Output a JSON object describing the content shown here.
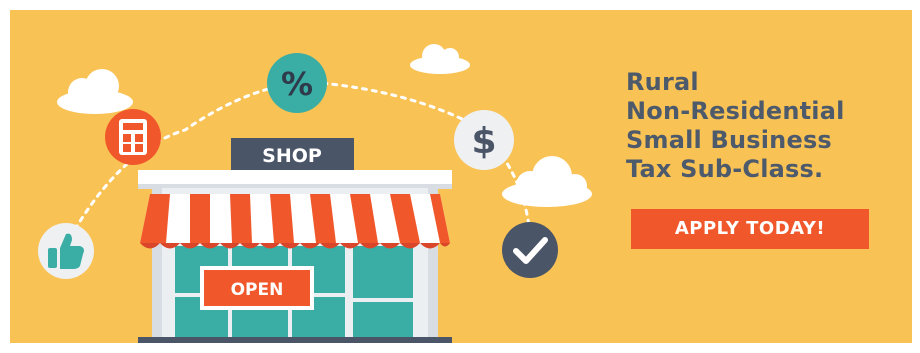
{
  "banner": {
    "headline_lines": [
      "Rural",
      "Non-Residential",
      "Small Business",
      "Tax Sub-Class."
    ],
    "cta_label": "APPLY TODAY!"
  },
  "shop": {
    "sign_label": "SHOP",
    "open_sign_label": "OPEN"
  },
  "icons": {
    "percent_symbol": "%",
    "dollar_symbol": "$"
  },
  "colors": {
    "background": "#f9c254",
    "text": "#4d5a6c",
    "accent": "#f0582b",
    "teal": "#3aaea5",
    "navy": "#4a5568"
  }
}
